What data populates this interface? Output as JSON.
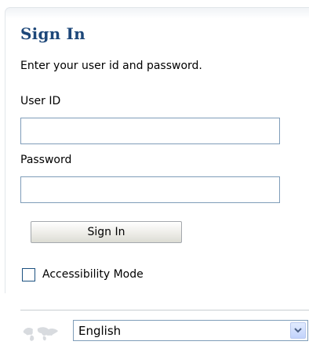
{
  "signin": {
    "title": "Sign In",
    "instructions": "Enter your user id and password.",
    "user_id_label": "User ID",
    "user_id_value": "",
    "password_label": "Password",
    "password_value": "",
    "button_label": "Sign In",
    "accessibility_label": "Accessibility Mode",
    "accessibility_checked": false
  },
  "language": {
    "selected": "English",
    "icon": "globe-icon"
  },
  "colors": {
    "title": "#1d4779",
    "field_border": "#7f9db9",
    "checkbox_border": "#1c5180"
  }
}
